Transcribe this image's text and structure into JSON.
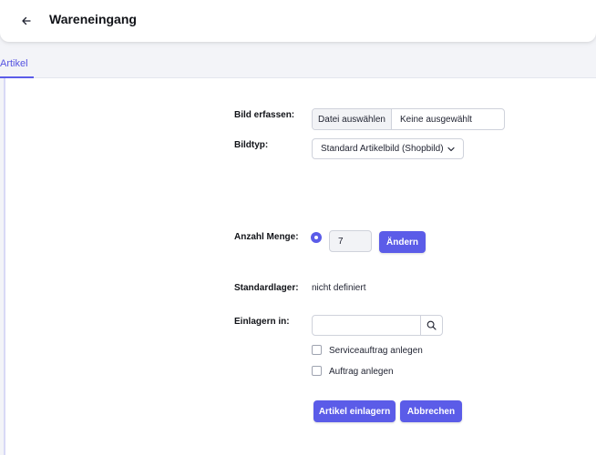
{
  "header": {
    "title": "Wareneingang"
  },
  "tabs": [
    {
      "label": "Artikel"
    }
  ],
  "form": {
    "bild_erfassen": {
      "label": "Bild erfassen:",
      "button_label": "Datei auswählen",
      "status": "Keine ausgewählt"
    },
    "bildtyp": {
      "label": "Bildtyp:",
      "selected": "Standard Artikelbild (Shopbild)"
    },
    "anzahl_menge": {
      "label": "Anzahl Menge:",
      "value": "7",
      "change_button": "Ändern"
    },
    "standardlager": {
      "label": "Standardlager:",
      "value": "nicht definiert"
    },
    "einlagern_in": {
      "label": "Einlagern in:",
      "value": ""
    },
    "checkboxes": [
      {
        "label": "Serviceauftrag anlegen"
      },
      {
        "label": "Auftrag anlegen"
      }
    ],
    "actions": {
      "submit": "Artikel einlagern",
      "cancel": "Abbrechen"
    }
  },
  "colors": {
    "accent": "#5b5ce8",
    "background": "#f3f4f8",
    "panel": "#ffffff"
  },
  "icons": {
    "back": "arrow-left-icon",
    "select": "chevron-down-icon",
    "search": "search-icon"
  }
}
